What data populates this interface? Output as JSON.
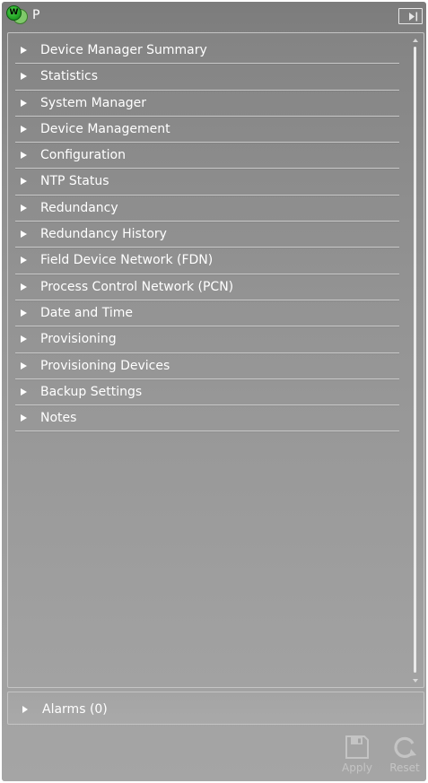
{
  "header": {
    "logo_letter": "W",
    "title": "P"
  },
  "nav": {
    "items": [
      {
        "label": "Device Manager Summary"
      },
      {
        "label": "Statistics"
      },
      {
        "label": "System Manager"
      },
      {
        "label": "Device Management"
      },
      {
        "label": "Configuration"
      },
      {
        "label": "NTP Status"
      },
      {
        "label": "Redundancy"
      },
      {
        "label": "Redundancy History"
      },
      {
        "label": "Field Device Network (FDN)"
      },
      {
        "label": "Process Control Network (PCN)"
      },
      {
        "label": "Date and Time"
      },
      {
        "label": "Provisioning"
      },
      {
        "label": "Provisioning Devices"
      },
      {
        "label": "Backup Settings"
      },
      {
        "label": "Notes"
      }
    ]
  },
  "alarms": {
    "label": "Alarms (0)"
  },
  "actions": {
    "apply_label": "Apply",
    "reset_label": "Reset",
    "apply_icon": "save-icon",
    "reset_icon": "reset-icon",
    "disabled": true
  },
  "colors": {
    "panel_gradient_top": "#848484",
    "panel_gradient_bottom": "#a2a2a2",
    "text": "#ffffff",
    "disabled_action": "#c4c4c4",
    "divider": "#c9c9c9",
    "logo_green": "#1e9e22"
  }
}
